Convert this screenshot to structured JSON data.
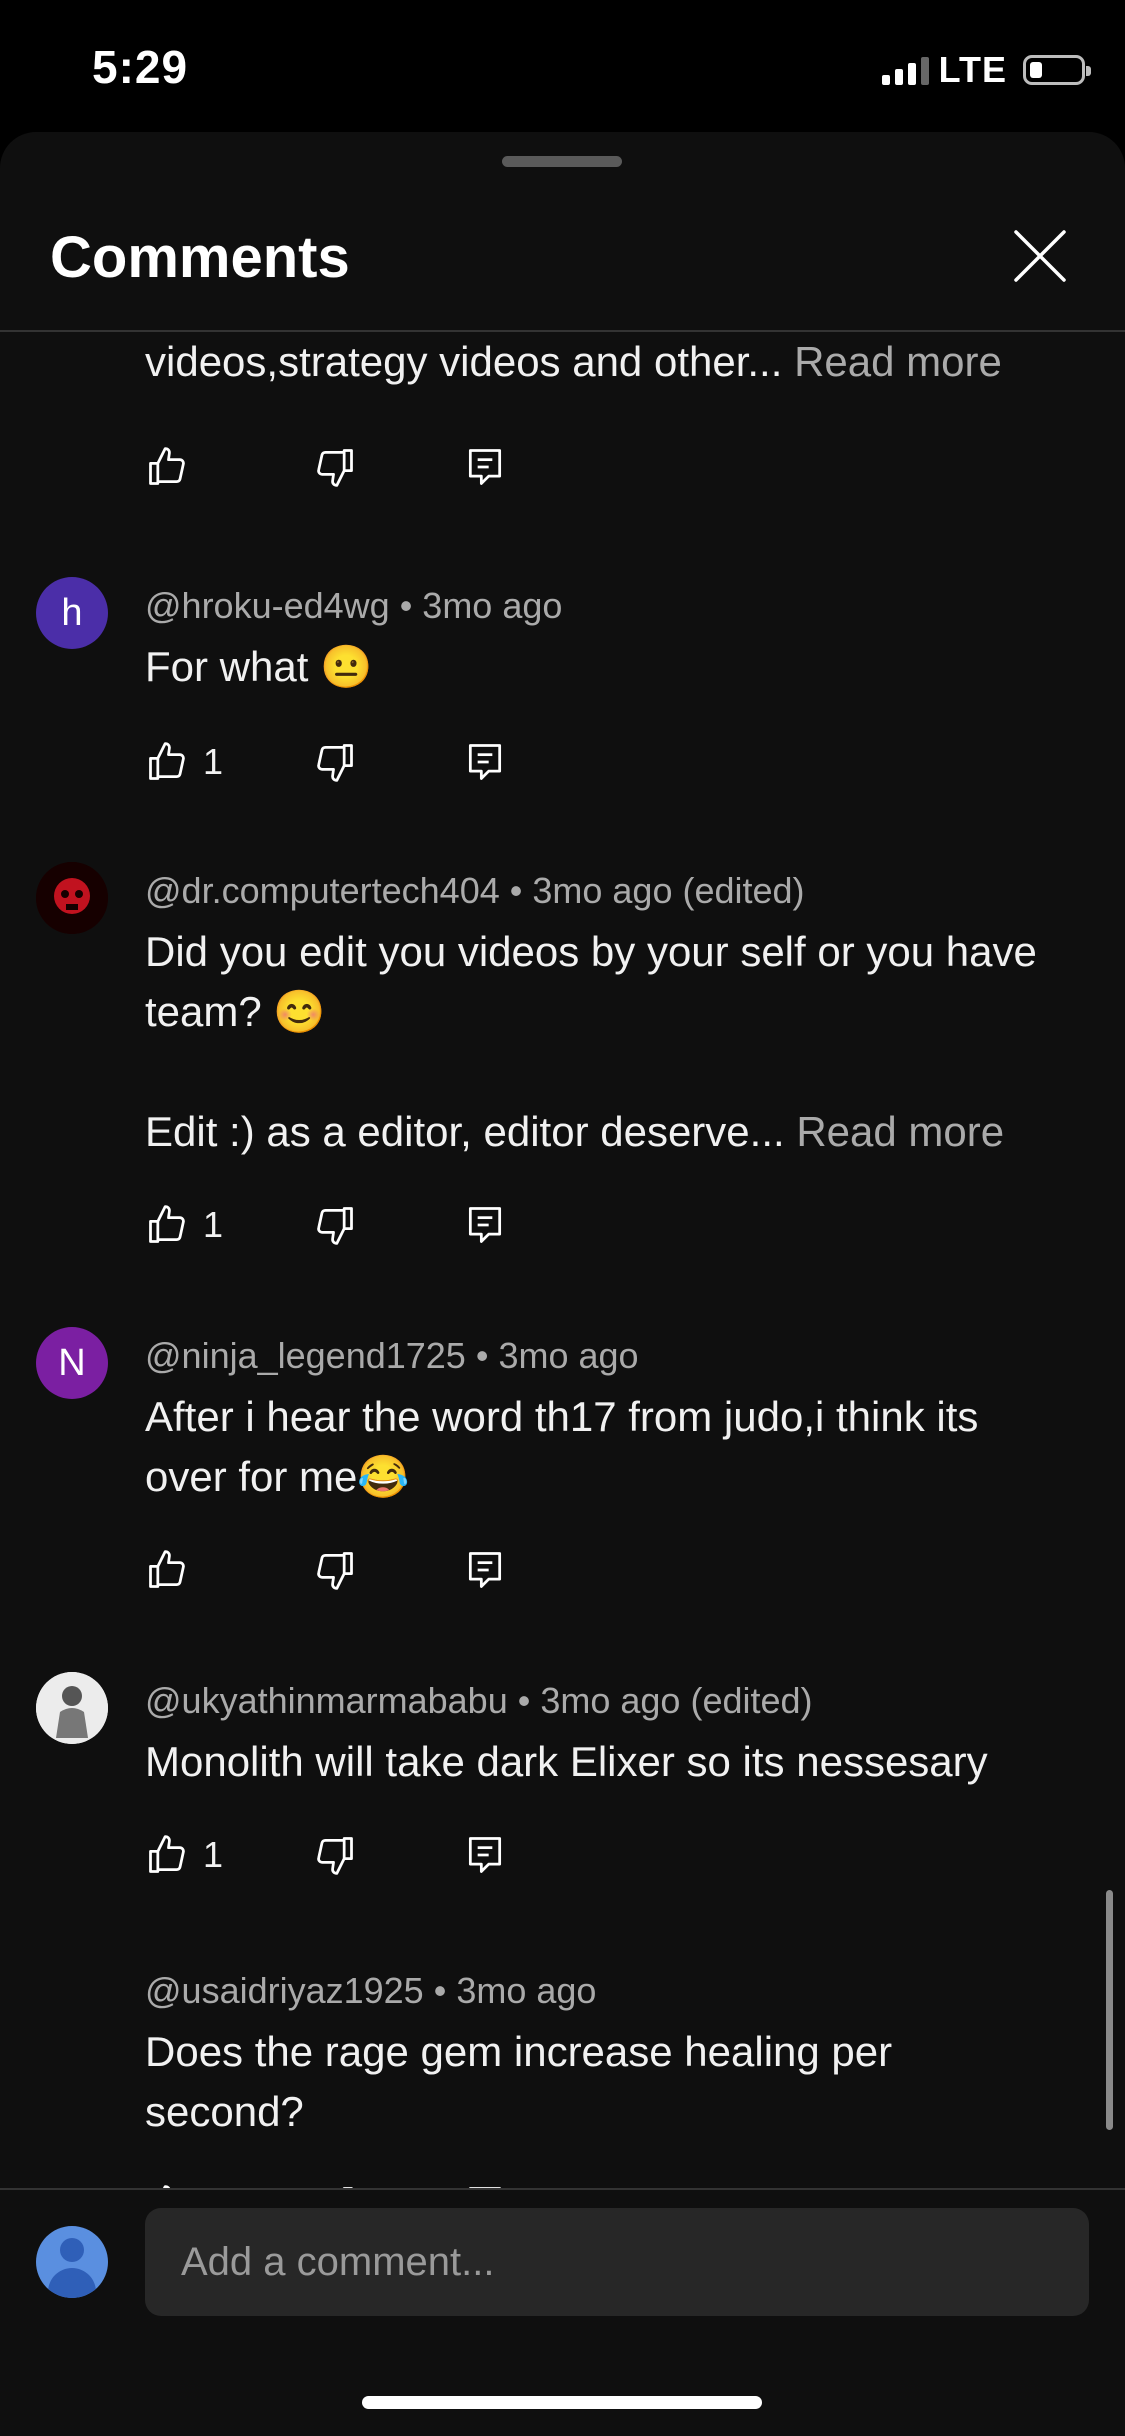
{
  "status_bar": {
    "time": "5:29",
    "network": "LTE"
  },
  "header": {
    "title": "Comments"
  },
  "comments": [
    {
      "text": "videos,strategy videos and other...",
      "read_more": "Read more",
      "likes": ""
    },
    {
      "avatar_letter": "h",
      "avatar_color": "#4b2ea8",
      "handle": "@hroku-ed4wg",
      "time": "3mo ago",
      "text": "For what 😐",
      "likes": "1"
    },
    {
      "avatar_color": "#1b0000",
      "handle": "@dr.computertech404",
      "time": "3mo ago (edited)",
      "text_lines": [
        "Did you edit you videos by your self or you have team? 😊",
        "Edit :) as a editor, editor deserve..."
      ],
      "read_more": "Read more",
      "likes": "1"
    },
    {
      "avatar_letter": "N",
      "avatar_color": "#7b1fa2",
      "handle": "@ninja_legend1725",
      "time": "3mo ago",
      "text": "After i hear the word th17 from judo,i think its over for me😂",
      "likes": ""
    },
    {
      "avatar_color": "#e9e9e9",
      "handle": "@ukyathinmarmababu",
      "time": "3mo ago (edited)",
      "text": "Monolith will take dark Elixer so its nessesary",
      "likes": "1"
    },
    {
      "handle": "@usaidriyaz1925",
      "time": "3mo ago",
      "text": "Does the rage gem increase healing per second?",
      "likes": ""
    }
  ],
  "composer": {
    "placeholder": "Add a comment..."
  },
  "icons": {
    "like": "thumbs-up-icon",
    "dislike": "thumbs-down-icon",
    "reply": "reply-icon",
    "close": "close-icon"
  }
}
